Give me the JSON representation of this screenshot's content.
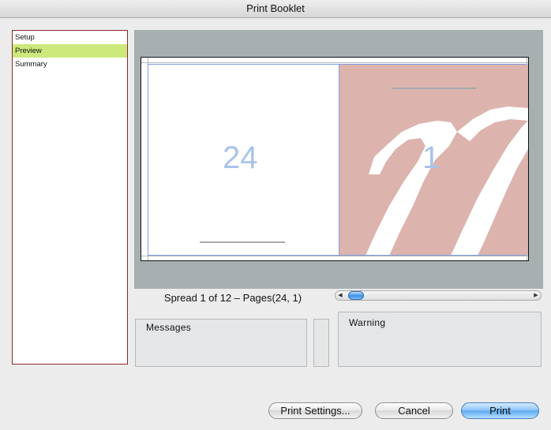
{
  "window": {
    "title": "Print Booklet"
  },
  "sidebar": {
    "items": [
      {
        "label": "Setup",
        "selected": false
      },
      {
        "label": "Preview",
        "selected": true
      },
      {
        "label": "Summary",
        "selected": false
      }
    ]
  },
  "preview": {
    "left_page_number": "24",
    "right_page_number": "1",
    "spread_label": "Spread 1 of 12 – Pages(24, 1)",
    "scroll_fraction": 0.02
  },
  "panels": {
    "messages_label": "Messages",
    "warning_label": "Warning"
  },
  "buttons": {
    "print_settings": "Print Settings...",
    "cancel": "Cancel",
    "print": "Print"
  },
  "colors": {
    "sidebar_selected": "#cde97c",
    "sidebar_border": "#8b2a2a",
    "art_fill": "#dcb4ad",
    "page_number": "#a9c3ea"
  }
}
